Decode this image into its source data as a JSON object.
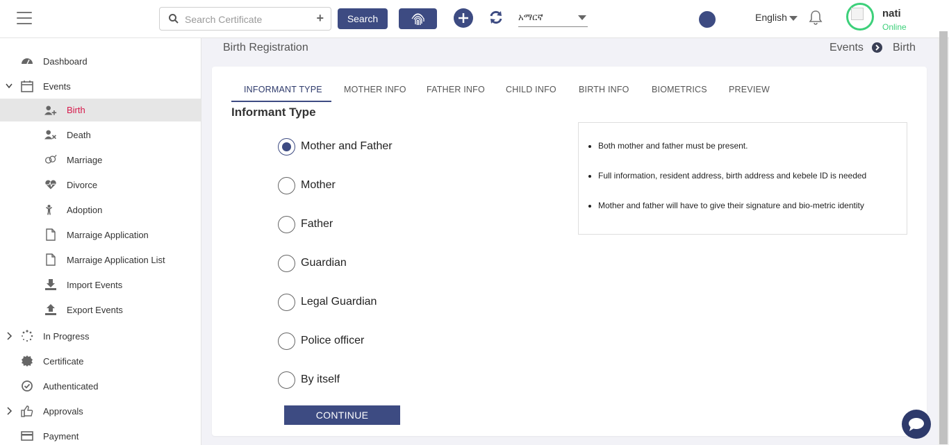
{
  "header": {
    "search_placeholder": "Search Certificate",
    "search_button": "Search",
    "language_select_value": "አማርኛ",
    "language_label": "English",
    "user_name": "nati",
    "user_status": "Online"
  },
  "sidebar": {
    "items": [
      {
        "label": "Dashboard",
        "icon": "dashboard-icon"
      },
      {
        "label": "Events",
        "icon": "calendar-icon"
      },
      {
        "label": "Birth",
        "icon": "add-person-icon"
      },
      {
        "label": "Death",
        "icon": "remove-person-icon"
      },
      {
        "label": "Marriage",
        "icon": "rings-icon"
      },
      {
        "label": "Divorce",
        "icon": "broken-heart-icon"
      },
      {
        "label": "Adoption",
        "icon": "child-icon"
      },
      {
        "label": "Marraige Application",
        "icon": "document-icon"
      },
      {
        "label": "Marraige Application List",
        "icon": "document-icon"
      },
      {
        "label": "Import Events",
        "icon": "download-icon"
      },
      {
        "label": "Export Events",
        "icon": "upload-icon"
      },
      {
        "label": "In Progress",
        "icon": "spinner-icon"
      },
      {
        "label": "Certificate",
        "icon": "certificate-icon"
      },
      {
        "label": "Authenticated",
        "icon": "check-circle-icon"
      },
      {
        "label": "Approvals",
        "icon": "thumbs-up-icon"
      },
      {
        "label": "Payment",
        "icon": "payment-card-icon"
      }
    ]
  },
  "page": {
    "title": "Birth Registration",
    "breadcrumb": [
      "Events",
      "Birth"
    ]
  },
  "tabs": [
    "INFORMANT TYPE",
    "MOTHER INFO",
    "FATHER INFO",
    "CHILD INFO",
    "BIRTH INFO",
    "BIOMETRICS",
    "PREVIEW"
  ],
  "form": {
    "section_title": "Informant Type",
    "options": [
      "Mother and Father",
      "Mother",
      "Father",
      "Guardian",
      "Legal Guardian",
      "Police officer",
      "By itself"
    ],
    "selected": "Mother and Father",
    "continue_label": "CONTINUE"
  },
  "info": {
    "items": [
      "Both mother and father must be present.",
      "Full information, resident address, birth address and kebele ID is needed",
      "Mother and father will have to give their signature and bio-metric identity"
    ]
  },
  "colors": {
    "primary": "#3d4b82",
    "active_nav_text": "#d6194b",
    "online": "#3dd07a"
  }
}
